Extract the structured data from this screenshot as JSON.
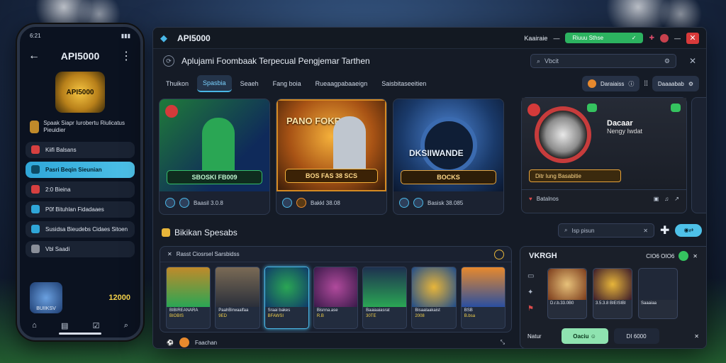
{
  "phone": {
    "time": "6:21",
    "title": "API5000",
    "logo_text": "API5000",
    "desc": "Spaak Siapr Iurobertu Riulicatus Pieuidier",
    "menu": [
      {
        "label": "Kiifi Balsans"
      },
      {
        "label": "Pasri Beqin Sieunian"
      },
      {
        "label": "2:0 Bieina"
      },
      {
        "label": "P0f Bituhlan Fidadaaes"
      },
      {
        "label": "Susidsa Bieudebs Cidaes Sitoen"
      },
      {
        "label": "Vbl Saadi"
      }
    ],
    "shield_label": "BUIIKSV",
    "score": "12000"
  },
  "window": {
    "title": "API5000",
    "topright_label": "Kaairaie",
    "green_btn": "Riuuu Sthse",
    "heading": "Aplujami  Foombaak Terpecual Pengjemar Tarthen",
    "search_placeholder": "Vbcit",
    "tabs": [
      "Thuikon",
      "Spasbia",
      "Seaeh",
      "Fang boia",
      "Rueaagpabaaeign",
      "Saisbitaseeitien"
    ],
    "right_pill": "Daraiaiss",
    "right_pill2": "Daaaabab"
  },
  "banners": [
    {
      "title": "",
      "cta": "SBOSKI FB009",
      "meta": "Baasil 3.0.8"
    },
    {
      "title": "PANO FOKRAN",
      "cta": "BOS FAS 38 SCS",
      "meta": "Bakkl 38.08"
    },
    {
      "title": "DKSIIWANDE",
      "cta": "BOCKS",
      "meta": "Basisk 38.085"
    }
  ],
  "promo": {
    "title": "Dacaar",
    "subtitle": "Nengy  Iwdat",
    "cta": "Ditr lung Basabitie",
    "meta": "Batalnos"
  },
  "section": {
    "title": "Bikikan Spesabs",
    "search_placeholder": "Isp pisun",
    "games_bar": "Rasst Ciosrsel Sarsbidss",
    "games": [
      {
        "name": "BIBIREANARA",
        "score": "BIOBIS"
      },
      {
        "name": "PaahBirwaalfaa",
        "score": "9ED"
      },
      {
        "name": "Sraai bakes",
        "score": "BFAWSI"
      },
      {
        "name": "Bisnna.ase",
        "score": "R.B"
      },
      {
        "name": "Baaiaaiasrat",
        "score": "30TE"
      },
      {
        "name": "Bisaalaakaist",
        "score": "2008"
      },
      {
        "name": "BSB",
        "score": "B.bsa"
      }
    ],
    "footer": "Faachan"
  },
  "side": {
    "title": "VKRGH",
    "head_right": "CIO6 OIO6",
    "cards": [
      {
        "name": "D.r.b.33.0B0"
      },
      {
        "name": "3.5.3.8 BIEISIBI"
      },
      {
        "name": "Saaaiaa"
      }
    ],
    "footer_label": "Natur",
    "footer_btn": "Oaciu",
    "footer_price": "DI  6000"
  },
  "colors": {
    "accent": "#4ab7e6",
    "green": "#2cb360",
    "red": "#d83a3a",
    "gold": "#e7b53a"
  }
}
